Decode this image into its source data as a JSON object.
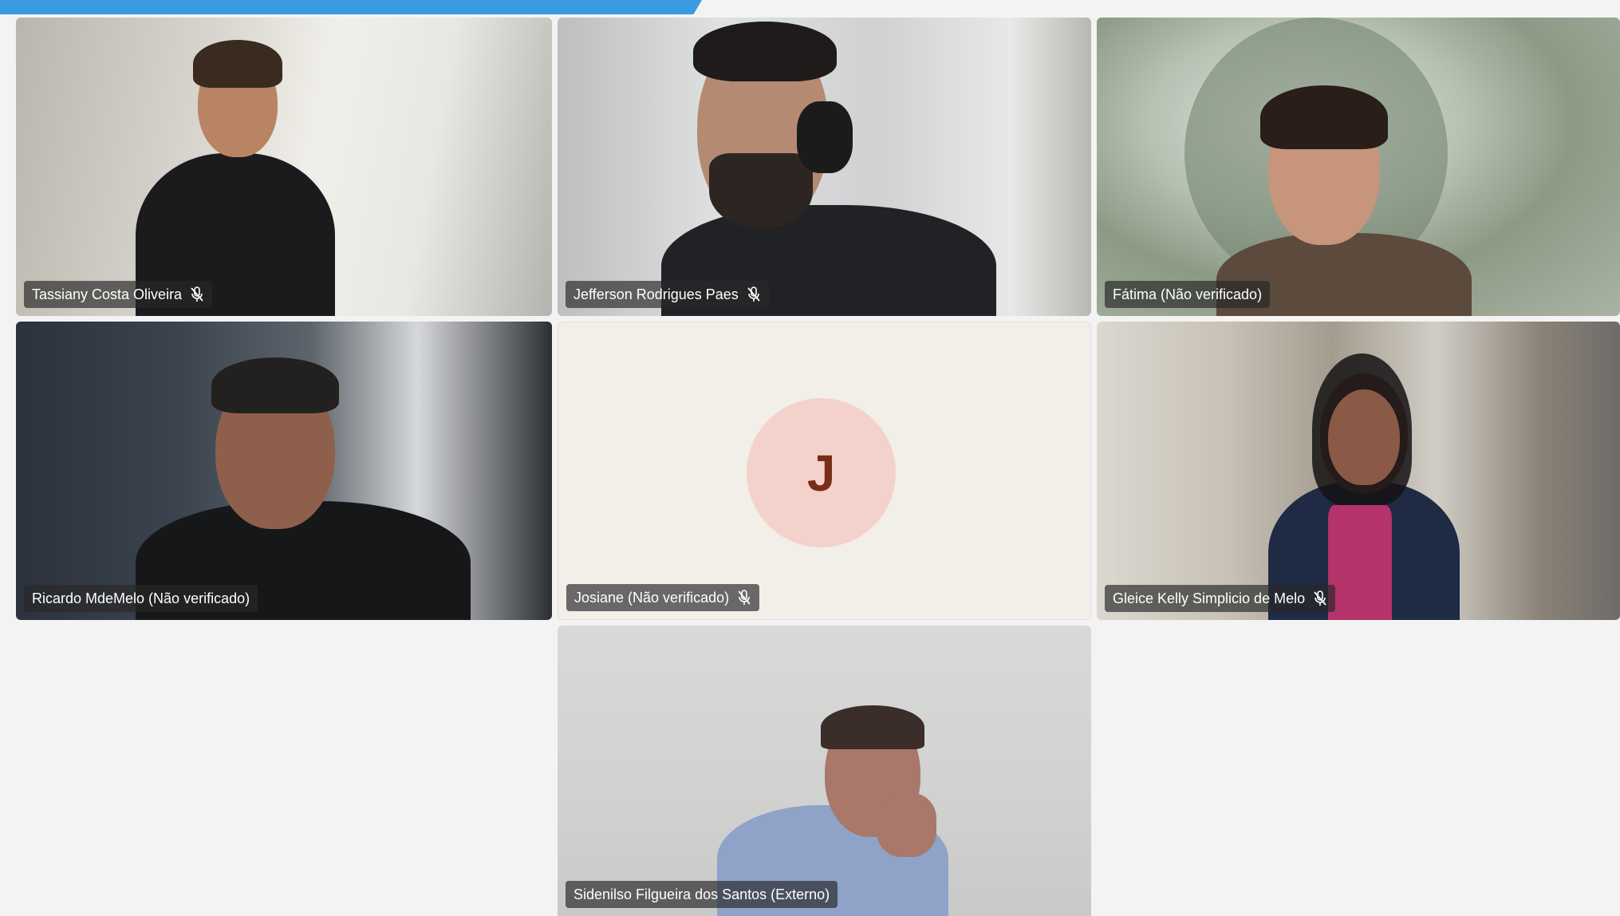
{
  "participants": [
    {
      "name": "Tassiany Costa Oliveira",
      "muted": true
    },
    {
      "name": "Jefferson Rodrigues Paes",
      "muted": true
    },
    {
      "name": "Fátima (Não verificado)",
      "muted": false
    },
    {
      "name": "Ricardo MdeMelo (Não verificado)",
      "muted": false
    },
    {
      "name": "Josiane (Não verificado)",
      "muted": true,
      "avatar_initial": "J"
    },
    {
      "name": "Gleice Kelly Simplicio de Melo",
      "muted": true
    },
    {
      "name": "Sidenilso Filgueira dos Santos (Externo)",
      "muted": false
    }
  ],
  "colors": {
    "accent_bar": "#3a9be0",
    "avatar_bg": "#f3d2cc",
    "avatar_text": "#7a2d1b",
    "stage_bg": "#f3f3f3"
  },
  "icons": {
    "muted": "mic-off-icon"
  }
}
